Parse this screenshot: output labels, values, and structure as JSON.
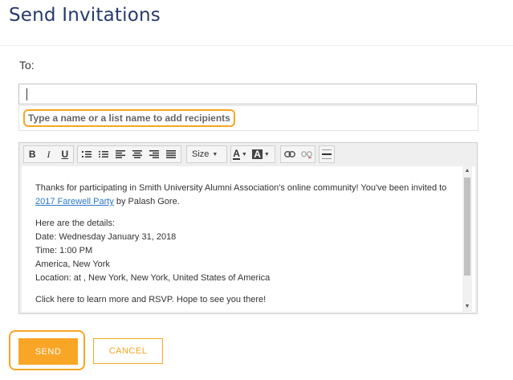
{
  "page": {
    "title": "Send Invitations"
  },
  "recipients": {
    "to_label": "To:",
    "input_value": "",
    "hint": "Type a name or a list name to add recipients"
  },
  "toolbar": {
    "bold": "B",
    "italic": "I",
    "underline": "U",
    "size_label": "Size",
    "text_color_label": "A",
    "bg_color_label": "A"
  },
  "message": {
    "intro": "Thanks for participating in Smith University Alumni Association's online community! You've been invited to",
    "event_link": "2017 Farewell Party",
    "by_text": " by Palash Gore.",
    "details_heading": "Here are the details:",
    "date_line": "Date: Wednesday January 31, 2018",
    "time_line": "Time: 1:00 PM",
    "tz_line": "America, New York",
    "location_line": "Location: at , New York, New York, United States of America",
    "cut_line": "Click here to learn more and RSVP. Hope to see you there!"
  },
  "actions": {
    "send_label": "SEND",
    "cancel_label": "CANCEL"
  },
  "colors": {
    "title": "#263a6b",
    "accent": "#f9a526",
    "link": "#2a77c9"
  }
}
